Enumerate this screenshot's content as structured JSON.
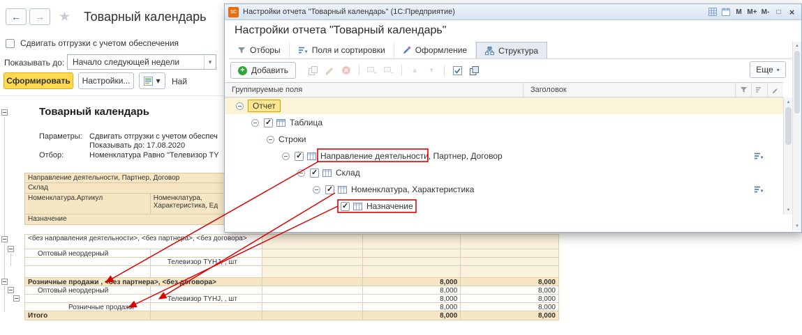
{
  "colors": {
    "primary_button": "#ffd94f",
    "selection_highlight": "#ffe792",
    "annotation": "#dd0000",
    "group_row": "#f6e6c4"
  },
  "icons": {
    "back": "←",
    "forward": "→",
    "star": "★",
    "caret_down": "▾",
    "up_arrow": "▲",
    "down_arrow": "▼"
  },
  "app": {
    "title": "Товарный календарь",
    "shift_checkbox_label": "Сдвигать отгрузки с учетом обеспечения",
    "show_until_label": "Показывать до:",
    "show_until_value": "Начало следующей недели",
    "generate_button": "Сформировать",
    "settings_button": "Настройки...",
    "find_button": "Най"
  },
  "report": {
    "title": "Товарный календарь",
    "params_label": "Параметры:",
    "param_line1": "Сдвигать отгрузки с учетом обеспеч",
    "param_line2": "Показывать до: 17.08.2020",
    "filter_label": "Отбор:",
    "filter_value": "Номенклатура Равно \"Телевизор TY",
    "col_group_header": "Направление деятельности, Партнер, Договор",
    "col_warehouse": "Склад",
    "col_article": "Номенклатура.Артикул",
    "col_nomenclature_line1": "Номенклатура,",
    "col_nomenclature_line2": "Характеристика, Ед",
    "col_purpose": "Назначение",
    "rows": [
      {
        "label": "<без направления деятельности>, <без партнера>, <без договора>",
        "v1": "",
        "v2": ""
      },
      {
        "label": "Оптовый неордерный",
        "v1": "",
        "v2": ""
      },
      {
        "label": "Телевизор TYHJ, , шт",
        "v1": "",
        "v2": ""
      },
      {
        "label": "Розничные продажи , <без партнера>, <без договора>",
        "v1": "8,000",
        "v2": "8,000"
      },
      {
        "label": "Оптовый неордерный",
        "v1": "8,000",
        "v2": "8,000"
      },
      {
        "label": "Телевизор TYHJ, , шт",
        "v1": "8,000",
        "v2": "8,000"
      },
      {
        "label": "Розничные продажи",
        "v1": "8,000",
        "v2": "8,000"
      },
      {
        "label": "Итого",
        "v1": "8,000",
        "v2": "8,000"
      }
    ]
  },
  "dialog": {
    "window_title": "Настройки отчета \"Товарный календарь\" (1С:Предприятие)",
    "mem_m": "М",
    "mem_m_plus": "М+",
    "mem_m_minus": "М-",
    "maximize": "□",
    "close": "×",
    "heading": "Настройки отчета \"Товарный календарь\"",
    "tabs": [
      {
        "label": "Отборы"
      },
      {
        "label": "Поля и сортировки"
      },
      {
        "label": "Оформление"
      },
      {
        "label": "Структура"
      }
    ],
    "active_tab": "Структура",
    "add_button": "Добавить",
    "more_button": "Еще",
    "col_fields": "Группируемые поля",
    "col_title": "Заголовок",
    "tree": [
      {
        "label": "Отчет"
      },
      {
        "label": "Таблица",
        "checked": true
      },
      {
        "label": "Строки"
      },
      {
        "label": "Направление деятельности, Партнер, Договор",
        "checked": true
      },
      {
        "label": "Склад",
        "checked": true
      },
      {
        "label": "Номенклатура, Характеристика",
        "checked": true
      },
      {
        "label": "Назначение",
        "checked": true
      }
    ]
  }
}
